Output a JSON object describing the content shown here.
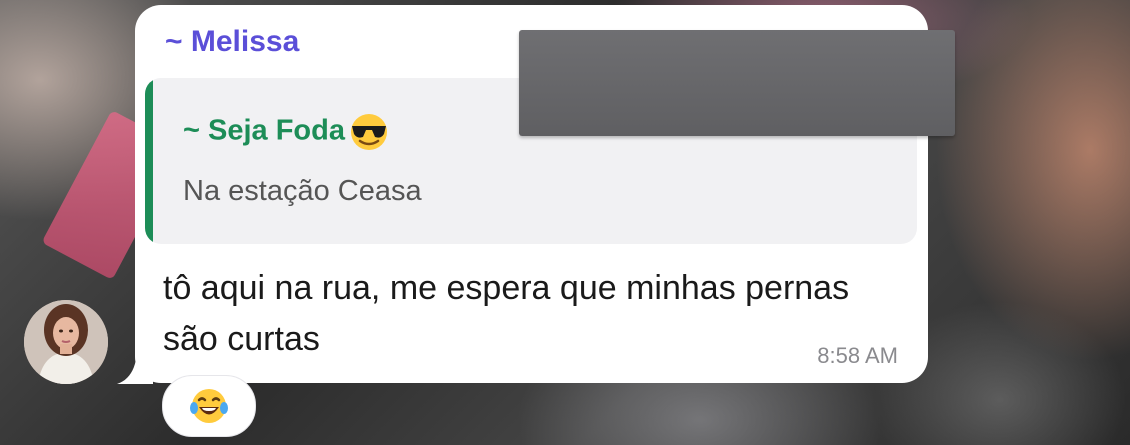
{
  "message": {
    "sender": "~ Melissa",
    "reply": {
      "sender": "~ Seja Foda",
      "text": "Na estação Ceasa"
    },
    "text": "tô aqui na rua, me espera que minhas pernas são curtas",
    "time": "8:58 AM",
    "reaction_emoji": "laughing-with-tears"
  },
  "colors": {
    "sender_name": "#5b4fd8",
    "reply_accent": "#1d8d57"
  }
}
